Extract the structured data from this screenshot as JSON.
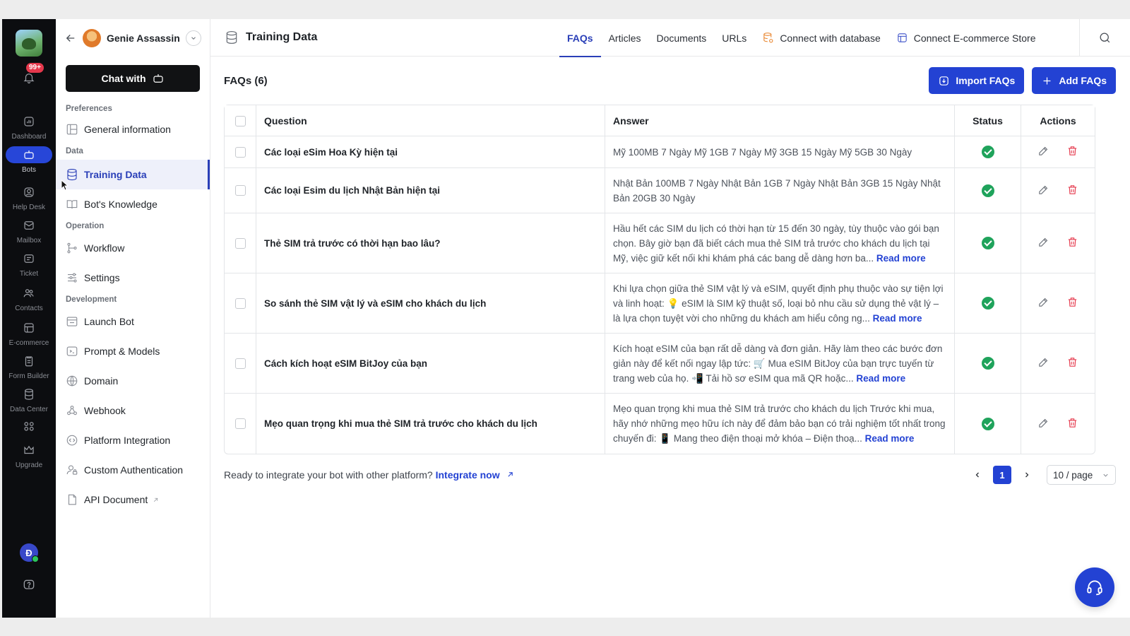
{
  "rail": {
    "badge": "99+",
    "items": [
      {
        "label": "Dashboard",
        "icon": "dashboard-icon"
      },
      {
        "label": "Bots",
        "icon": "bot-icon"
      },
      {
        "label": "Help Desk",
        "icon": "help-desk-icon"
      },
      {
        "label": "Mailbox",
        "icon": "mail-icon"
      },
      {
        "label": "Ticket",
        "icon": "ticket-icon"
      },
      {
        "label": "Contacts",
        "icon": "contacts-icon"
      },
      {
        "label": "E-commerce",
        "icon": "store-icon"
      },
      {
        "label": "Form Builder",
        "icon": "form-icon"
      },
      {
        "label": "Data Center",
        "icon": "database-icon"
      },
      {
        "label": "",
        "icon": "apps-icon"
      },
      {
        "label": "Upgrade",
        "icon": "crown-icon"
      }
    ],
    "avatar_letter": "Đ"
  },
  "sidebar": {
    "user_name": "Genie Assassin",
    "chat_label": "Chat with",
    "sections": {
      "preferences": "Preferences",
      "data": "Data",
      "operation": "Operation",
      "development": "Development"
    },
    "items": {
      "general": "General information",
      "training": "Training Data",
      "knowledge": "Bot's Knowledge",
      "workflow": "Workflow",
      "settings": "Settings",
      "launch": "Launch Bot",
      "prompt": "Prompt & Models",
      "domain": "Domain",
      "webhook": "Webhook",
      "platform": "Platform Integration",
      "custom_auth": "Custom Authentication",
      "api": "API Document"
    }
  },
  "header": {
    "title": "Training Data",
    "tabs": [
      "FAQs",
      "Articles",
      "Documents",
      "URLs",
      "Connect with database",
      "Connect E-commerce Store"
    ],
    "active_tab": "FAQs"
  },
  "faqs": {
    "title": "FAQs (6)",
    "import_label": "Import FAQs",
    "add_label": "Add FAQs",
    "columns": [
      "Question",
      "Answer",
      "Status",
      "Actions"
    ],
    "read_more": "Read more",
    "rows": [
      {
        "q": "Các loại eSim Hoa Kỳ hiện tại",
        "a": "Mỹ 100MB 7 Ngày Mỹ 1GB 7 Ngày Mỹ 3GB 15 Ngày Mỹ 5GB 30 Ngày",
        "more": false
      },
      {
        "q": "Các loại Esim du lịch Nhật Bản hiện tại",
        "a": "Nhật Bản 100MB 7 Ngày Nhật Bản 1GB 7 Ngày Nhật Bản 3GB 15 Ngày Nhật Bản 20GB 30 Ngày",
        "more": false
      },
      {
        "q": "Thẻ SIM trả trước có thời hạn bao lâu?",
        "a": "Hầu hết các SIM du lịch có thời hạn từ 15 đến 30 ngày, tùy thuộc vào gói bạn chọn. Bây giờ bạn đã biết cách mua thẻ SIM trả trước cho khách du lịch tại Mỹ, việc giữ kết nối khi khám phá các bang dễ dàng hơn ba...",
        "more": true
      },
      {
        "q": "So sánh thẻ SIM vật lý và eSIM cho khách du lịch",
        "a": "Khi lựa chọn giữa thẻ SIM vật lý và eSIM, quyết định phụ thuộc vào sự tiện lợi và linh hoạt: 💡 eSIM là SIM kỹ thuật số, loại bỏ nhu cầu sử dụng thẻ vật lý – là lựa chọn tuyệt vời cho những du khách am hiểu công ng...",
        "more": true
      },
      {
        "q": "Cách kích hoạt eSIM BitJoy của bạn",
        "a": "Kích hoạt eSIM của bạn rất dễ dàng và đơn giản. Hãy làm theo các bước đơn giản này để kết nối ngay lập tức: 🛒 Mua eSIM BitJoy của bạn trực tuyến từ trang web của họ. 📲 Tải hồ sơ eSIM qua mã QR hoặc...",
        "more": true
      },
      {
        "q": "Mẹo quan trọng khi mua thẻ SIM trả trước cho khách du lịch",
        "a": "Mẹo quan trọng khi mua thẻ SIM trả trước cho khách du lịch Trước khi mua, hãy nhớ những mẹo hữu ích này để đảm bảo bạn có trải nghiệm tốt nhất trong chuyến đi: 📱 Mang theo điện thoại mở khóa – Điện thoạ...",
        "more": true
      }
    ]
  },
  "footer": {
    "integrate_text": "Ready to integrate your bot with other platform?",
    "integrate_link": "Integrate now",
    "page": "1",
    "per_page": "10 / page"
  },
  "colors": {
    "accent": "#2342d3",
    "success": "#1fa35b",
    "danger": "#e5384c"
  }
}
